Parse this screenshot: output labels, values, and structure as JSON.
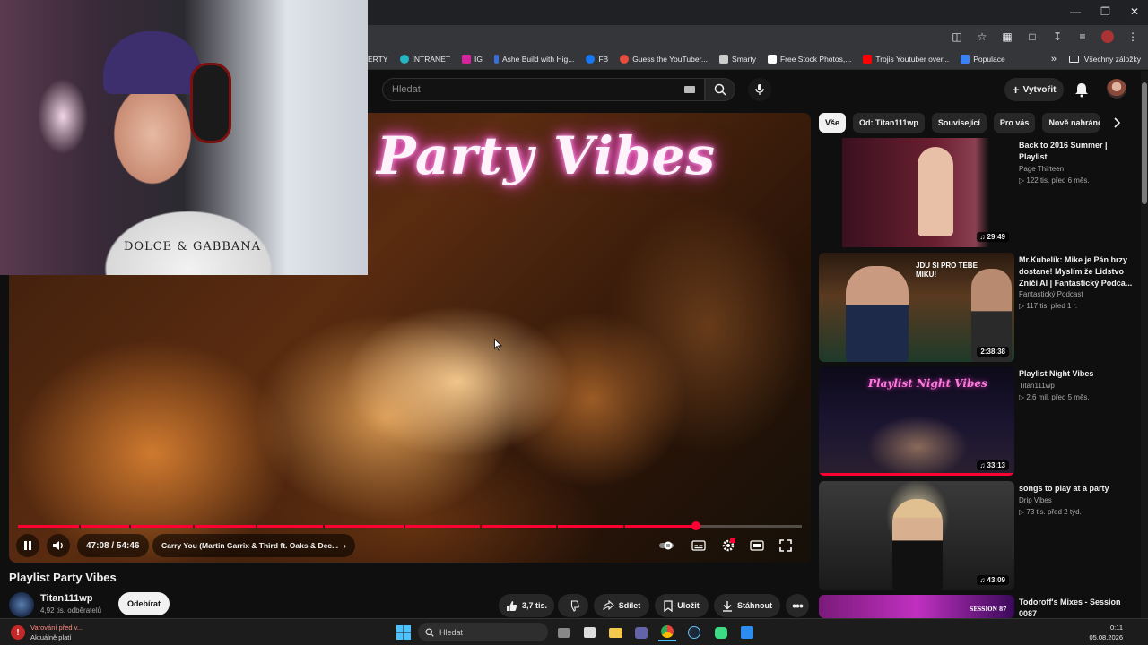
{
  "bookmarks": {
    "items": [
      {
        "label": "ERTY",
        "color": "#0b57d0"
      },
      {
        "label": "INTRANET",
        "color": "#25b5c5"
      },
      {
        "label": "IG",
        "color": "#d6249f"
      },
      {
        "label": "Ashe Build with Hig...",
        "color": "#3a6fd8"
      },
      {
        "label": "FB",
        "color": "#1877f2"
      },
      {
        "label": "Guess the YouTuber...",
        "color": "#e74c3c"
      },
      {
        "label": "Smarty",
        "color": "#cccccc"
      },
      {
        "label": "Free Stock Photos,...",
        "color": "#ffffff"
      },
      {
        "label": "Trojis Youtuber over...",
        "color": "#ff0000"
      },
      {
        "label": "Populace",
        "color": "#3b82f6"
      }
    ],
    "all_label": "Všechny záložky"
  },
  "header": {
    "search_placeholder": "Hledat",
    "create_label": "Vytvořit"
  },
  "video": {
    "overlay_title": "Party Vibes",
    "progress_percent": 86.5,
    "time": "47:08 / 54:46",
    "chapter": "Carry You (Martin Garrix & Third ft. Oaks & Dec..."
  },
  "webcam": {
    "shirt_text": "DOLCE & GABBANA"
  },
  "meta": {
    "title": "Playlist Party Vibes",
    "channel": "Titan111wp",
    "subscribers": "4,92 tis. odběratelů",
    "subscribe_label": "Odebírat",
    "likes": "3,7 tis.",
    "share_label": "Sdílet",
    "save_label": "Uložit",
    "download_label": "Stáhnout"
  },
  "chips": [
    "Vše",
    "Od: Titan111wp",
    "Související",
    "Pro vás",
    "Nově nahráno"
  ],
  "recommendations": [
    {
      "title": "Back to 2016 Summer | Playlist",
      "channel": "Page Thirteen",
      "meta": "▷ 122 tis.   před 6 měs.",
      "duration": "29:49"
    },
    {
      "title": "Mr.Kubelík: Mike je Pán brzy dostane! Myslím že Lidstvo Zničí AI | Fantastický Podca...",
      "channel": "Fantastický Podcast",
      "meta": "▷ 117 tis.   před 1 r.",
      "duration": "2:38:38",
      "thumb_text": "JDU SI PRO TEBE MIKU!"
    },
    {
      "title": "Playlist Night Vibes",
      "channel": "Titan111wp",
      "meta": "▷ 2,6 mil.   před 5 měs.",
      "duration": "33:13",
      "thumb_text": "Playlist Night Vibes"
    },
    {
      "title": "songs to play at a party",
      "channel": "Drip Vibes",
      "meta": "▷ 73 tis.   před 2 týd.",
      "duration": "43:09"
    },
    {
      "title": "Todoroff's Mixes - Session 0087",
      "thumb_text": "SESSION 87"
    }
  ],
  "taskbar": {
    "warning_title": "Varování před v...",
    "warning_sub": "Aktuálně platí",
    "search_placeholder": "Hledat",
    "time": "0:11",
    "date": "05.08.2026"
  }
}
